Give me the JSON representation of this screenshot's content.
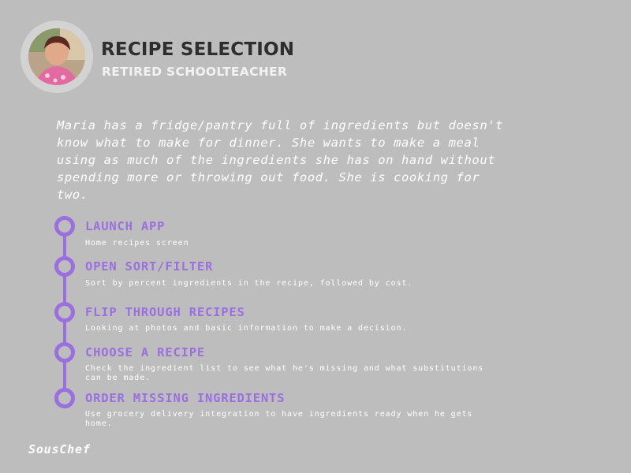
{
  "persona": {
    "title": "RECIPE SELECTION",
    "subtitle": "RETIRED SCHOOLTEACHER"
  },
  "scenario": "Maria has a fridge/pantry full of ingredients but doesn't know what to make for dinner. She wants to make a meal using as much of the ingredients she has on hand without spending more or throwing out food. She is cooking for two.",
  "steps": [
    {
      "title": "LAUNCH APP",
      "description": "Home recipes screen"
    },
    {
      "title": "OPEN SORT/FILTER",
      "description": "Sort by percent ingredients in the recipe, followed by cost."
    },
    {
      "title": "FLIP THROUGH RECIPES",
      "description": "Looking at photos and basic information to make a decision."
    },
    {
      "title": "CHOOSE A RECIPE",
      "description": "Check the ingredient list to see what he's missing and what substitutions can be made."
    },
    {
      "title": "ORDER MISSING INGREDIENTS",
      "description": "Use grocery delivery integration to have ingredients ready when he gets home."
    }
  ],
  "brand": "SousChef",
  "colors": {
    "background": "#bdbdbd",
    "accent": "#9a6fe0",
    "title": "#2e2e2e",
    "text": "#ffffff"
  },
  "icons": {
    "avatar": "persona-photo"
  }
}
